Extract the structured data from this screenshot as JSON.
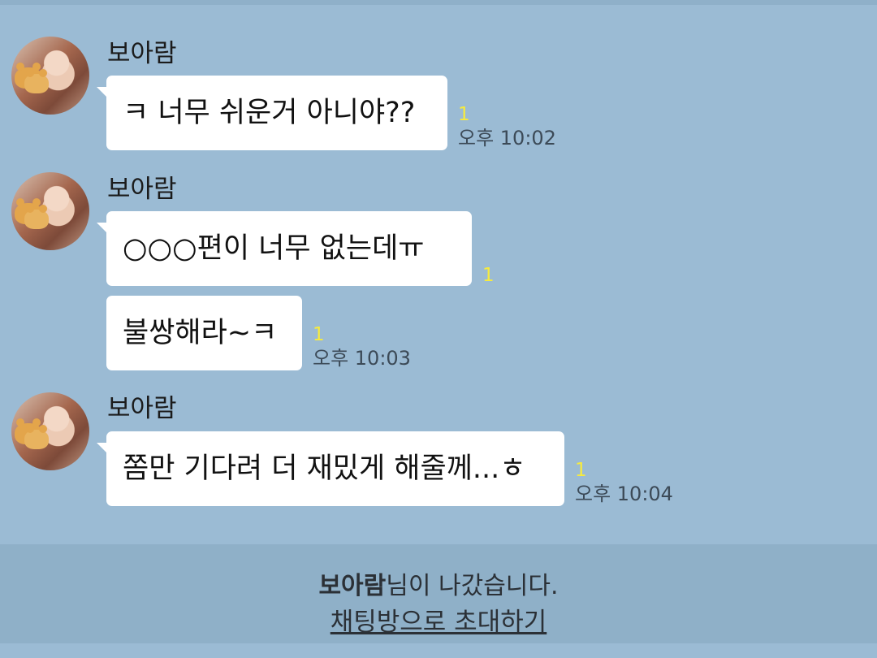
{
  "messages": [
    {
      "sender": "보아람",
      "bubbles": [
        {
          "text": "ㅋ 너무 쉬운거 아니야??",
          "unread": "1",
          "time": "오후 10:02"
        }
      ]
    },
    {
      "sender": "보아람",
      "bubbles": [
        {
          "text": "○○○편이 너무 없는데ㅠ",
          "unread": "1",
          "time": ""
        },
        {
          "text": "불쌍해라~ㅋ",
          "unread": "1",
          "time": "오후 10:03"
        }
      ]
    },
    {
      "sender": "보아람",
      "bubbles": [
        {
          "text": "쫌만 기다려 더 재밌게 해줄께...ㅎ",
          "unread": "1",
          "time": "오후 10:04"
        }
      ]
    }
  ],
  "footer": {
    "left_user": "보아람",
    "left_suffix": "님이 나갔습니다.",
    "invite_label": "채팅방으로 초대하기"
  },
  "colors": {
    "background": "#9bbbd4",
    "bubble": "#ffffff",
    "unread": "#f7eb3d",
    "footer": "#8fb0c8"
  }
}
